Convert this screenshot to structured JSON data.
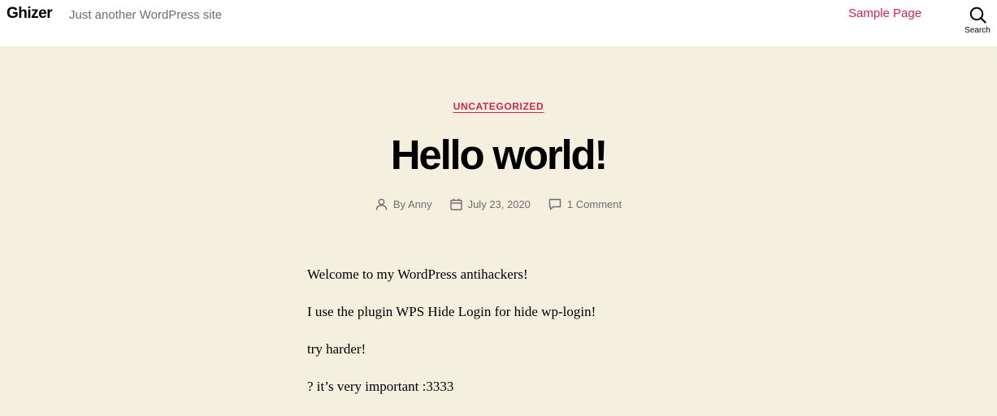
{
  "header": {
    "site_title": "Ghizer",
    "site_description": "Just another WordPress site",
    "nav": [
      {
        "label": "Sample Page"
      }
    ],
    "search_label": "Search"
  },
  "post": {
    "category": "UNCATEGORIZED",
    "title": "Hello world!",
    "meta": {
      "author": "By Anny",
      "date": "July 23, 2020",
      "comments": "1 Comment"
    },
    "paragraphs": [
      "Welcome to my WordPress antihackers!",
      "I use the plugin WPS Hide Login for hide wp-login!",
      "try harder!",
      "? it’s very important :3333"
    ]
  },
  "icons": {
    "search": "search-icon",
    "author": "user-icon",
    "date": "calendar-icon",
    "comments": "comment-icon"
  },
  "colors": {
    "accent": "#cd2653",
    "background": "#f5efe0",
    "header_bg": "#ffffff",
    "meta_text": "#6d6d6d"
  }
}
